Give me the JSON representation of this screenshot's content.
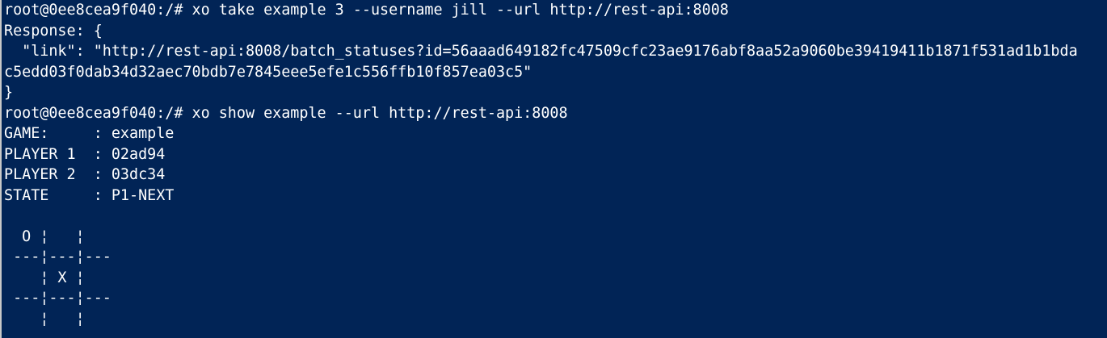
{
  "terminal": {
    "lines": [
      "root@0ee8cea9f040:/# xo take example 3 --username jill --url http://rest-api:8008",
      "Response: {",
      "  \"link\": \"http://rest-api:8008/batch_statuses?id=56aaad649182fc47509cfc23ae9176abf8aa52a9060be39419411b1871f531ad1b1bda",
      "c5edd03f0dab34d32aec70bdb7e7845eee5efe1c556ffb10f857ea03c5\"",
      "}",
      "root@0ee8cea9f040:/# xo show example --url http://rest-api:8008",
      "GAME:     : example",
      "PLAYER 1  : 02ad94",
      "PLAYER 2  : 03dc34",
      "STATE     : P1-NEXT",
      "",
      "  O ¦   ¦",
      " ---¦---¦---",
      "    ¦ X ¦",
      " ---¦---¦---",
      "    ¦   ¦"
    ]
  }
}
